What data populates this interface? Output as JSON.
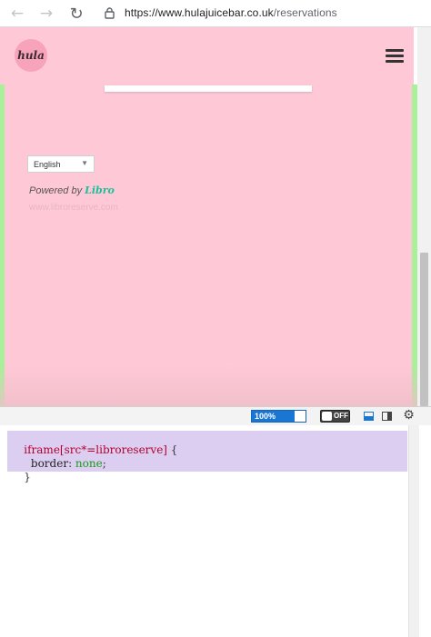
{
  "browser": {
    "back_icon": "←",
    "forward_icon": "→",
    "reload_icon": "↻",
    "url_host": "https://www.hulajuicebar.co.uk",
    "url_path": "/reservations"
  },
  "site": {
    "logo_text": "hula",
    "language_selected": "English",
    "language_caret": "▼",
    "powered_by": "Powered by",
    "powered_brand": "Libro",
    "faint_text": "www.libroreserve.com"
  },
  "devtools": {
    "zoom_label": "100%",
    "zoom_level": 0.8,
    "toggle_label": "OFF",
    "settings_icon": "⚙"
  },
  "editor": {
    "line1_selector": "iframe[src*=libroreserve]",
    "line1_brace": " {",
    "line2_property": "  border",
    "line2_colon": ": ",
    "line2_value": "none",
    "line2_semicolon": ";",
    "line3_brace": "}"
  },
  "colors": {
    "page_background": "#ffc8d6",
    "side_accent": "#a8f09a",
    "zoom_accent": "#1976d2",
    "code_selector": "#b4002d",
    "code_value": "#1a9a1a"
  }
}
